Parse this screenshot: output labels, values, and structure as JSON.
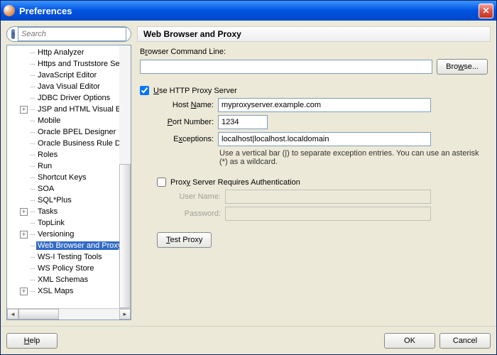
{
  "window": {
    "title": "Preferences"
  },
  "search": {
    "placeholder": "Search"
  },
  "tree": {
    "items": [
      {
        "label": "Http Analyzer",
        "expand": null
      },
      {
        "label": "Https and Truststore Settin",
        "expand": null
      },
      {
        "label": "JavaScript Editor",
        "expand": null
      },
      {
        "label": "Java Visual Editor",
        "expand": null
      },
      {
        "label": "JDBC Driver Options",
        "expand": null
      },
      {
        "label": "JSP and HTML Visual Editor",
        "expand": "+"
      },
      {
        "label": "Mobile",
        "expand": null
      },
      {
        "label": "Oracle BPEL Designer",
        "expand": null
      },
      {
        "label": "Oracle Business Rule Desig",
        "expand": null
      },
      {
        "label": "Roles",
        "expand": null
      },
      {
        "label": "Run",
        "expand": null
      },
      {
        "label": "Shortcut Keys",
        "expand": null
      },
      {
        "label": "SOA",
        "expand": null
      },
      {
        "label": "SQL*Plus",
        "expand": null
      },
      {
        "label": "Tasks",
        "expand": "+"
      },
      {
        "label": "TopLink",
        "expand": null
      },
      {
        "label": "Versioning",
        "expand": "+"
      },
      {
        "label": "Web Browser and Proxy",
        "expand": null,
        "selected": true
      },
      {
        "label": "WS-I Testing Tools",
        "expand": null
      },
      {
        "label": "WS Policy Store",
        "expand": null
      },
      {
        "label": "XML Schemas",
        "expand": null
      },
      {
        "label": "XSL Maps",
        "expand": "+"
      }
    ]
  },
  "panel": {
    "title": "Web Browser and Proxy",
    "browserCmdLabelPre": "B",
    "browserCmdLabelU": "r",
    "browserCmdLabelPost": "owser Command Line:",
    "browserCmdValue": "",
    "browseBtnPre": "Bro",
    "browseBtnU": "w",
    "browseBtnPost": "se...",
    "useProxyPre": "",
    "useProxyU": "U",
    "useProxyPost": "se HTTP Proxy Server",
    "hostLabelPre": "Host ",
    "hostLabelU": "N",
    "hostLabelPost": "ame:",
    "hostValue": "myproxyserver.example.com",
    "portLabelPre": "",
    "portLabelU": "P",
    "portLabelPost": "ort Number:",
    "portValue": "1234",
    "exceptLabelPre": "E",
    "exceptLabelU": "x",
    "exceptLabelPost": "ceptions:",
    "exceptValue": "localhost|localhost.localdomain",
    "exceptHint": "Use a vertical bar (|) to separate exception entries.  You can use an asterisk (*) as a wildcard.",
    "authLabelPre": "Prox",
    "authLabelU": "y",
    "authLabelPost": " Server Requires Authentication",
    "userLabel": "User Name:",
    "passLabel": "Password:",
    "testBtnPre": "",
    "testBtnU": "T",
    "testBtnPost": "est Proxy"
  },
  "footer": {
    "helpPre": "",
    "helpU": "H",
    "helpPost": "elp",
    "ok": "OK",
    "cancel": "Cancel"
  }
}
